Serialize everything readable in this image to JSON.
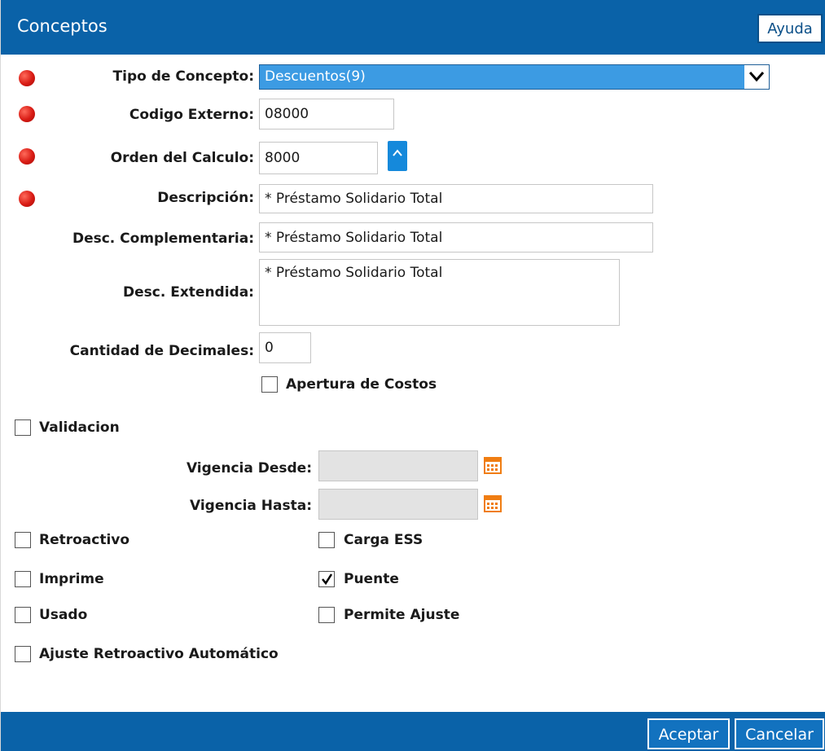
{
  "dialog": {
    "title": "Conceptos",
    "help_label": "Ayuda"
  },
  "form": {
    "tipo_concepto": {
      "label": "Tipo de Concepto:",
      "value": "Descuentos(9)"
    },
    "codigo_externo": {
      "label": "Codigo Externo:",
      "value": "08000"
    },
    "orden_calculo": {
      "label": "Orden del Calculo:",
      "value": "8000"
    },
    "descripcion": {
      "label": "Descripción:",
      "value": "* Préstamo Solidario Total"
    },
    "desc_complementaria": {
      "label": "Desc. Complementaria:",
      "value": "* Préstamo Solidario Total"
    },
    "desc_extendida": {
      "label": "Desc. Extendida:",
      "value": "* Préstamo Solidario Total"
    },
    "cantidad_decimales": {
      "label": "Cantidad de Decimales:",
      "value": "0"
    },
    "apertura_costos": {
      "label": "Apertura de Costos",
      "checked": false
    },
    "validacion": {
      "label": "Validacion",
      "checked": false
    },
    "vigencia_desde": {
      "label": "Vigencia Desde:",
      "value": ""
    },
    "vigencia_hasta": {
      "label": "Vigencia Hasta:",
      "value": ""
    },
    "checkboxes": {
      "retroactivo": {
        "label": "Retroactivo",
        "checked": false
      },
      "carga_ess": {
        "label": "Carga ESS",
        "checked": false
      },
      "imprime": {
        "label": "Imprime",
        "checked": false
      },
      "puente": {
        "label": "Puente",
        "checked": true
      },
      "usado": {
        "label": "Usado",
        "checked": false
      },
      "permite_ajuste": {
        "label": "Permite Ajuste",
        "checked": false
      },
      "ajuste_retroactivo": {
        "label": "Ajuste Retroactivo Automático",
        "checked": false
      }
    }
  },
  "footer": {
    "accept_label": "Aceptar",
    "cancel_label": "Cancelar"
  },
  "colors": {
    "header_bg": "#0a62a8",
    "select_bg": "#3c9be3",
    "required_dot": "#d81b14",
    "calendar_icon": "#f07d12"
  }
}
